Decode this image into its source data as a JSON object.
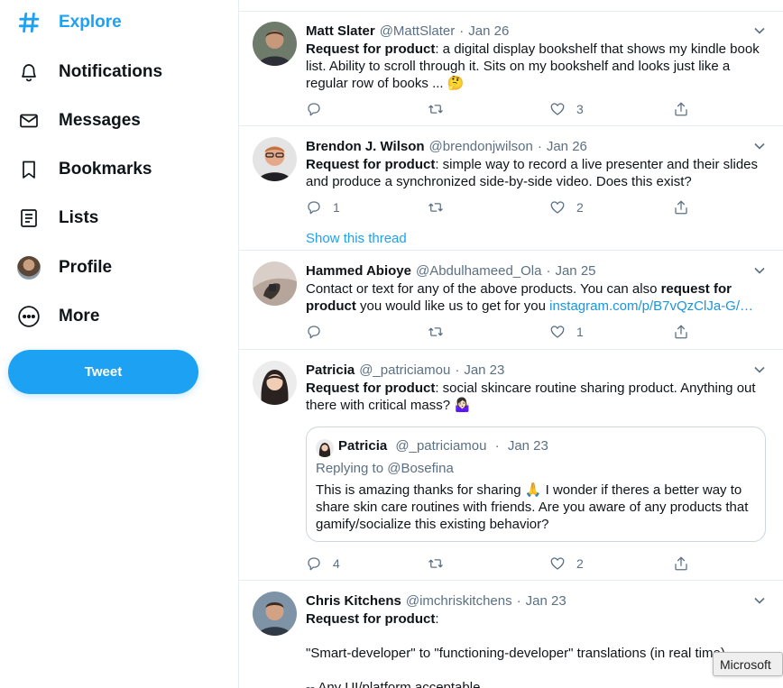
{
  "nav": {
    "explore": "Explore",
    "notifications": "Notifications",
    "messages": "Messages",
    "bookmarks": "Bookmarks",
    "lists": "Lists",
    "profile": "Profile",
    "more": "More",
    "tweet_button": "Tweet"
  },
  "tweets": [
    {
      "name": "Matt Slater",
      "handle": "@MattSlater",
      "dot": "·",
      "date": "Jan 26",
      "bold": "Request for product",
      "text": ": a digital display bookshelf that shows my kindle book list. Ability to scroll through it. Sits on my bookshelf and looks just like a regular row of books ... 🤔",
      "replies": "",
      "retweets": "",
      "likes": "3"
    },
    {
      "name": "Brendon J. Wilson",
      "handle": "@brendonjwilson",
      "dot": "·",
      "date": "Jan 26",
      "bold": "Request for product",
      "text": ": simple way to record a live presenter and their slides and produce a synchronized side-by-side video. Does this exist?",
      "replies": "1",
      "retweets": "",
      "likes": "2",
      "show_thread": "Show this thread"
    },
    {
      "name": "Hammed Abioye",
      "handle": "@Abdulhameed_Ola",
      "dot": "·",
      "date": "Jan 25",
      "text1": "Contact or text for any of the above products. You can also ",
      "bold1": "request for",
      "bold2": "product",
      "text2": " you would like us to get for you ",
      "link": "instagram.com/p/B7vQzClJa-G/…",
      "replies": "",
      "retweets": "",
      "likes": "1"
    },
    {
      "name": "Patricia",
      "handle": "@_patriciamou",
      "dot": "·",
      "date": "Jan 23",
      "bold": "Request for product",
      "text": ": social skincare routine sharing product. Anything out there with critical mass? 🤷🏻‍♀️",
      "quote": {
        "name": "Patricia",
        "handle": "@_patriciamou",
        "dot": "·",
        "date": "Jan 23",
        "replying": "Replying to @Bosefina",
        "text": "This is amazing thanks for sharing 🙏 I wonder if theres a better way to share skin care routines with friends. Are you aware of any products that gamify/socialize this existing behavior?"
      },
      "replies": "4",
      "retweets": "",
      "likes": "2"
    },
    {
      "name": "Chris Kitchens",
      "handle": "@imchriskitchens",
      "dot": "·",
      "date": "Jan 23",
      "bold": "Request for product",
      "text": ":",
      "line2": "\"Smart-developer\" to \"functioning-developer\" translations (in real time)",
      "line3": "-- Any UI/platform acceptable"
    }
  ],
  "tooltip": "Microsoft"
}
